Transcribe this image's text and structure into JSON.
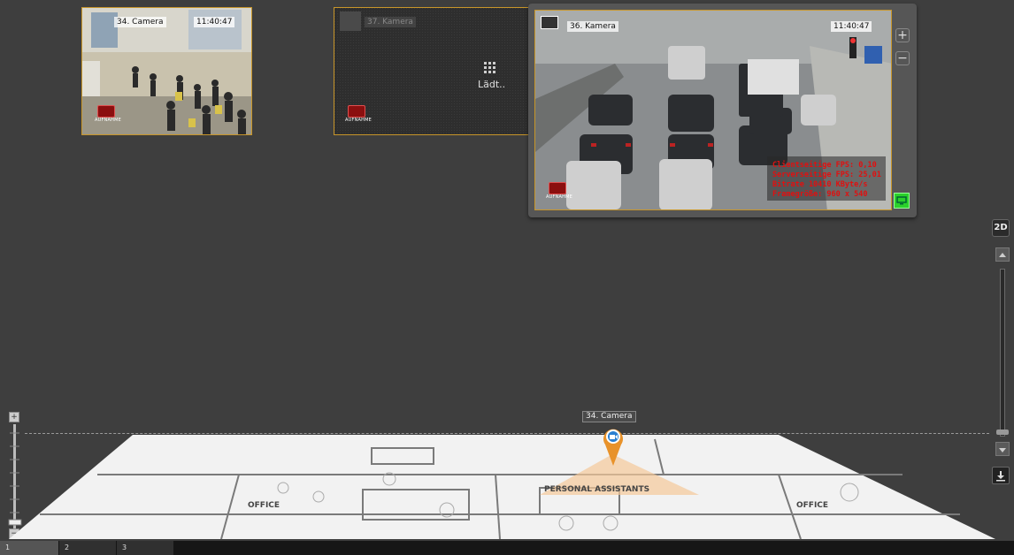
{
  "cameras": [
    {
      "label": "34. Camera",
      "time": "11:40:47",
      "rec_label": "AUFNAHME"
    },
    {
      "label": "37. Kamera",
      "status": "Lädt..",
      "rec_label": "AUFNAHME"
    },
    {
      "label": "36. Kamera",
      "time": "11:40:47",
      "rec_label": "AUFNAHME",
      "stats": [
        "Clientseitige FPS: 0,10",
        "Serverseitige FPS: 25,01",
        "Bitrate 10410 KByte/s",
        "Framegröße: 960 x 540"
      ]
    }
  ],
  "camera_panel": {
    "zoom_in": "+",
    "zoom_out": "−"
  },
  "view_mode_button": "2D",
  "map": {
    "marker_label": "34. Camera",
    "room_labels": [
      "OFFICE",
      "PERSONAL ASSISTANTS",
      "OFFICE"
    ]
  },
  "tabs": [
    "1",
    "2",
    "3"
  ],
  "colors": {
    "accent": "#c8962a",
    "background": "#3e3e3e",
    "osd_red": "#e01010",
    "marker": "#e8922a"
  }
}
